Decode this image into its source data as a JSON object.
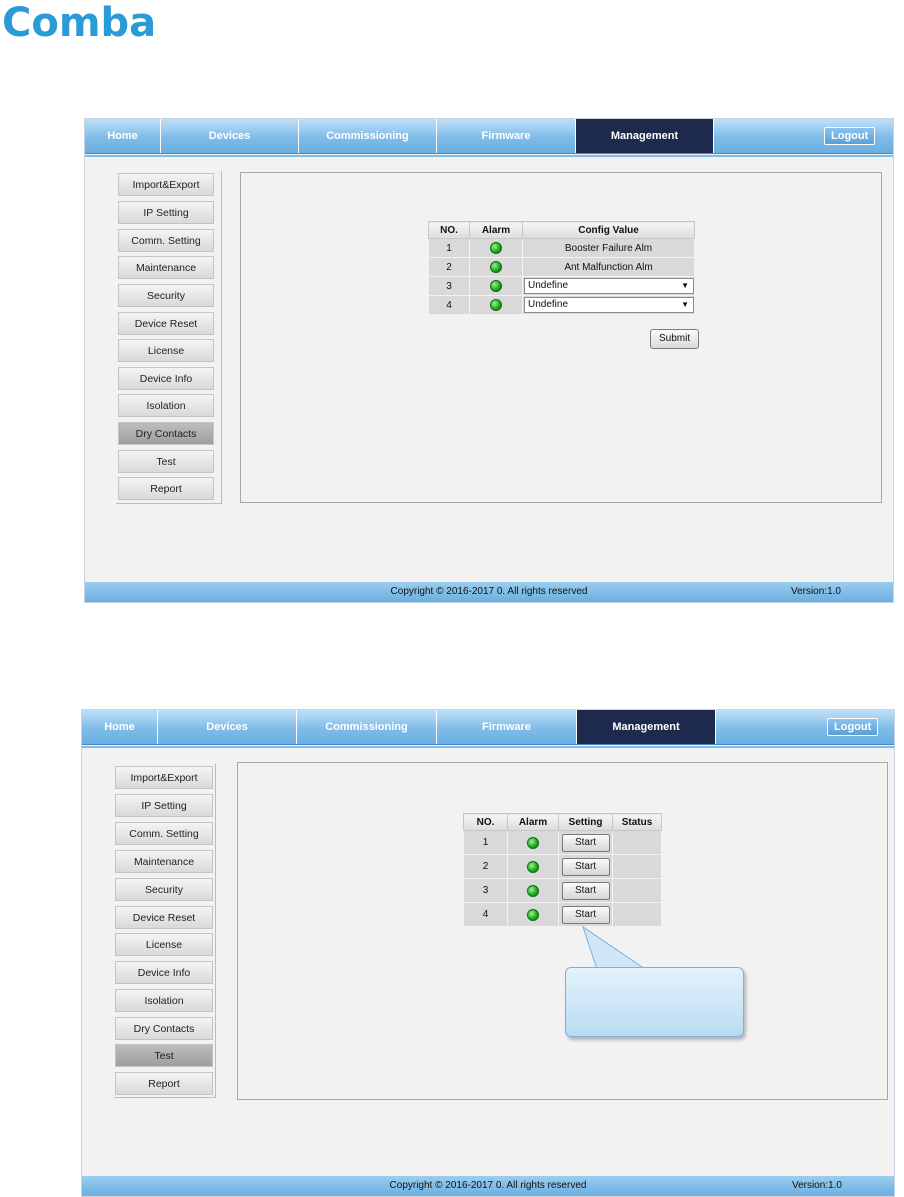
{
  "logo": {
    "text": "Comba",
    "color": "#2a9bd6"
  },
  "nav": {
    "tabs": [
      {
        "label": "Home"
      },
      {
        "label": "Devices"
      },
      {
        "label": "Commissioning"
      },
      {
        "label": "Firmware"
      },
      {
        "label": "Management",
        "active": true
      }
    ],
    "logout_label": "Logout"
  },
  "sidebar": {
    "items": [
      {
        "label": "Import&Export"
      },
      {
        "label": "IP Setting"
      },
      {
        "label": "Comm. Setting"
      },
      {
        "label": "Maintenance"
      },
      {
        "label": "Security"
      },
      {
        "label": "Device Reset"
      },
      {
        "label": "License"
      },
      {
        "label": "Device Info"
      },
      {
        "label": "Isolation"
      },
      {
        "label": "Dry Contacts"
      },
      {
        "label": "Test"
      },
      {
        "label": "Report"
      }
    ]
  },
  "screen1": {
    "active_item": "Dry Contacts",
    "table": {
      "headers": {
        "no": "NO.",
        "alarm": "Alarm",
        "config": "Config Value"
      },
      "rows": [
        {
          "no": "1",
          "config": "Booster Failure Alm",
          "type": "text"
        },
        {
          "no": "2",
          "config": "Ant Malfunction Alm",
          "type": "text"
        },
        {
          "no": "3",
          "config": "Undefine",
          "type": "select"
        },
        {
          "no": "4",
          "config": "Undefine",
          "type": "select"
        }
      ]
    },
    "submit_label": "Submit"
  },
  "screen2": {
    "active_item": "Test",
    "table": {
      "headers": {
        "no": "NO.",
        "alarm": "Alarm",
        "setting": "Setting",
        "status": "Status"
      },
      "rows": [
        {
          "no": "1",
          "setting": "Start",
          "status": ""
        },
        {
          "no": "2",
          "setting": "Start",
          "status": ""
        },
        {
          "no": "3",
          "setting": "Start",
          "status": ""
        },
        {
          "no": "4",
          "setting": "Start",
          "status": ""
        }
      ]
    }
  },
  "footer": {
    "copyright": "Copyright © 2016-2017 0. All rights reserved",
    "version": "Version:1.0"
  },
  "colors": {
    "nav_active": "#1d2a4e",
    "nav_bar": "#7fbce8",
    "alarm_ok": "#18a31a"
  }
}
